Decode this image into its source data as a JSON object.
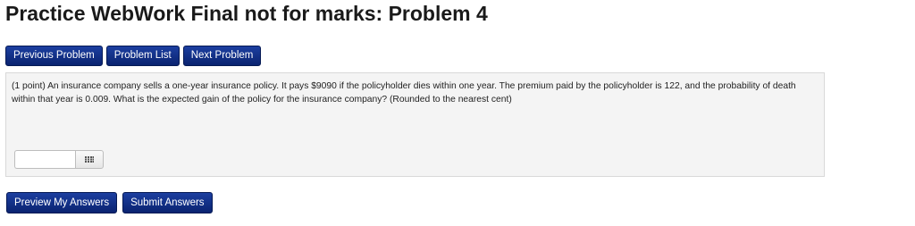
{
  "page": {
    "title": "Practice WebWork Final not for marks: Problem 4"
  },
  "nav": {
    "previous_label": "Previous Problem",
    "list_label": "Problem List",
    "next_label": "Next Problem"
  },
  "problem": {
    "text": "(1 point) An insurance company sells a one-year insurance policy. It pays $9090 if the policyholder dies within one year. The premium paid by the policyholder is 122, and the probability of death within that year is 0.009. What is the expected gain of the policy for the insurance company? (Rounded to the nearest cent)",
    "answer_value": "",
    "palette_icon": "grid-icon"
  },
  "actions": {
    "preview_label": "Preview My Answers",
    "submit_label": "Submit Answers"
  },
  "colors": {
    "button_bg": "#0a2370",
    "problem_bg": "#f4f4f4"
  }
}
